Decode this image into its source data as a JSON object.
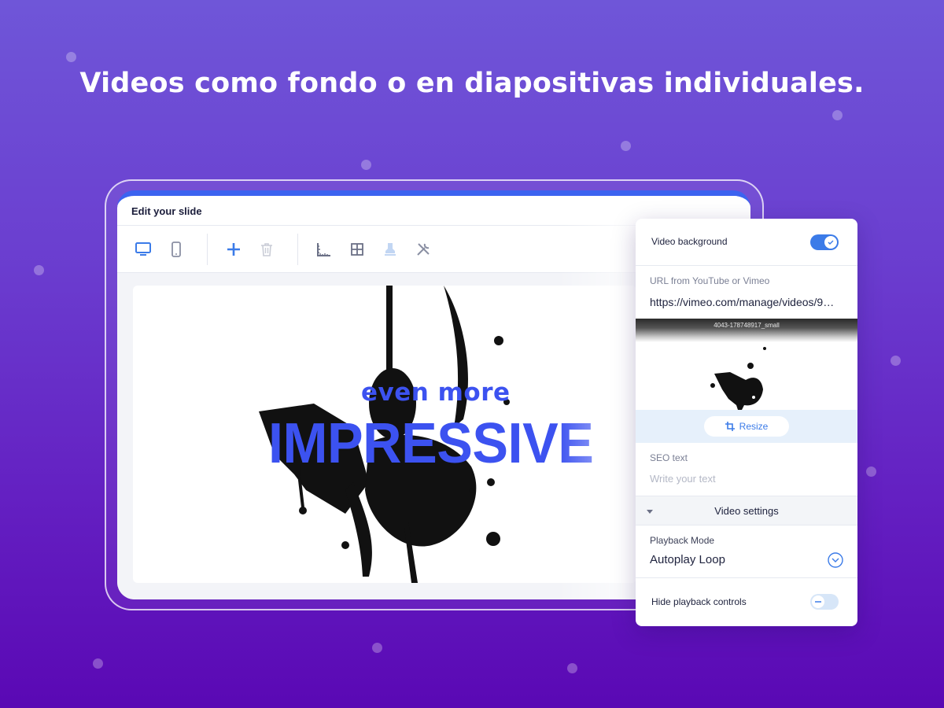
{
  "headline": "Videos como fondo o en diapositivas individuales.",
  "editor": {
    "title": "Edit your slide",
    "toolbar_icons": [
      "desktop-icon",
      "mobile-icon",
      "plus-icon",
      "trash-icon",
      "ruler-icon",
      "grid-icon",
      "stamp-icon",
      "tools-icon",
      "undo-icon",
      "redo-icon"
    ]
  },
  "slide": {
    "line1": "even more",
    "line2": "IMPRESSIVE"
  },
  "panel": {
    "video_background_label": "Video background",
    "video_background_on": true,
    "url_label": "URL from YouTube or Vimeo",
    "url_value": "https://vimeo.com/manage/videos/9…",
    "preview_caption": "4043-178748917_small",
    "resize_label": "Resize",
    "seo_label": "SEO text",
    "seo_placeholder": "Write your text",
    "video_settings_label": "Video settings",
    "playback_mode_label": "Playback Mode",
    "playback_mode_value": "Autoplay Loop",
    "hide_controls_label": "Hide playback controls",
    "hide_controls_on": false
  },
  "colors": {
    "accent": "#3b7be8",
    "slide_text": "#3c52f0",
    "editor_top_bar": "#3c63f0"
  }
}
